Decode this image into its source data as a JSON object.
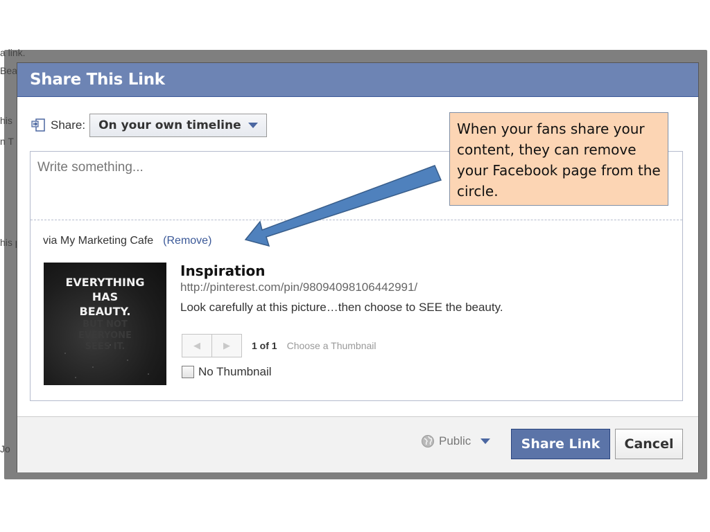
{
  "background": {
    "fragments": [
      "a link.",
      "Bea",
      "his",
      "n T",
      "his p",
      "Jo"
    ]
  },
  "dialog": {
    "title": "Share This Link",
    "share_label": "Share:",
    "share_target": "On your own timeline",
    "textarea_placeholder": "Write something...",
    "via_text": "via My Marketing Cafe",
    "remove_label": "(Remove)",
    "thumbnail": {
      "caption_lines": [
        "EVERYTHING",
        "HAS",
        "BEAUTY."
      ],
      "faded_lines": [
        "BUT NOT",
        "EVERYONE",
        "SEES IT."
      ]
    },
    "link": {
      "title": "Inspiration",
      "url": "http://pinterest.com/pin/98094098106442991/",
      "description": "Look carefully at this picture…then choose to SEE the beauty."
    },
    "pager": {
      "count": "1 of 1",
      "choose_label": "Choose a Thumbnail"
    },
    "no_thumbnail_label": "No Thumbnail",
    "footer": {
      "audience": "Public",
      "share_button": "Share Link",
      "cancel_button": "Cancel"
    }
  },
  "callout": {
    "text": "When your fans share your content, they can remove your Facebook page from the circle.",
    "fill_color": "#fcd5b4",
    "arrow_color": "#4f81bd"
  },
  "colors": {
    "header_bg": "#6d84b4",
    "link_blue": "#3b5998",
    "button_blue": "#5b74a8"
  }
}
